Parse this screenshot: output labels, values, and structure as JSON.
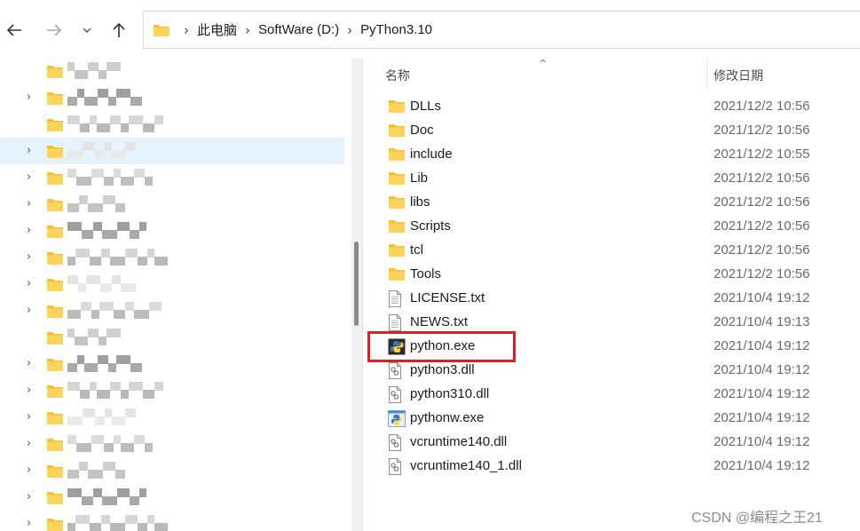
{
  "nav": {
    "back_icon": "arrow-left-icon",
    "forward_icon": "arrow-right-icon",
    "recent_icon": "chevron-down-icon",
    "up_icon": "arrow-up-icon"
  },
  "address": {
    "crumbs": [
      "此电脑",
      "SoftWare (D:)",
      "PyThon3.10"
    ],
    "separator": "›"
  },
  "columns": {
    "name": "名称",
    "date": "修改日期",
    "sort_indicator": "^"
  },
  "files": [
    {
      "name": "DLLs",
      "date": "2021/12/2 10:56",
      "type": "folder"
    },
    {
      "name": "Doc",
      "date": "2021/12/2 10:56",
      "type": "folder"
    },
    {
      "name": "include",
      "date": "2021/12/2 10:55",
      "type": "folder"
    },
    {
      "name": "Lib",
      "date": "2021/12/2 10:56",
      "type": "folder"
    },
    {
      "name": "libs",
      "date": "2021/12/2 10:56",
      "type": "folder"
    },
    {
      "name": "Scripts",
      "date": "2021/12/2 10:56",
      "type": "folder"
    },
    {
      "name": "tcl",
      "date": "2021/12/2 10:56",
      "type": "folder"
    },
    {
      "name": "Tools",
      "date": "2021/12/2 10:56",
      "type": "folder"
    },
    {
      "name": "LICENSE.txt",
      "date": "2021/10/4 19:12",
      "type": "text"
    },
    {
      "name": "NEWS.txt",
      "date": "2021/10/4 19:13",
      "type": "text"
    },
    {
      "name": "python.exe",
      "date": "2021/10/4 19:12",
      "type": "python-exe"
    },
    {
      "name": "python3.dll",
      "date": "2021/10/4 19:12",
      "type": "dll"
    },
    {
      "name": "python310.dll",
      "date": "2021/10/4 19:12",
      "type": "dll"
    },
    {
      "name": "pythonw.exe",
      "date": "2021/10/4 19:12",
      "type": "pythonw-exe"
    },
    {
      "name": "vcruntime140.dll",
      "date": "2021/10/4 19:12",
      "type": "dll"
    },
    {
      "name": "vcruntime140_1.dll",
      "date": "2021/10/4 19:12",
      "type": "dll"
    }
  ],
  "highlighted_file": "python.exe",
  "highlight_color": "#e02020",
  "folder_color": "#f8c131",
  "selection_color": "#e5f3ff",
  "watermark": "CSDN @编程之王21"
}
